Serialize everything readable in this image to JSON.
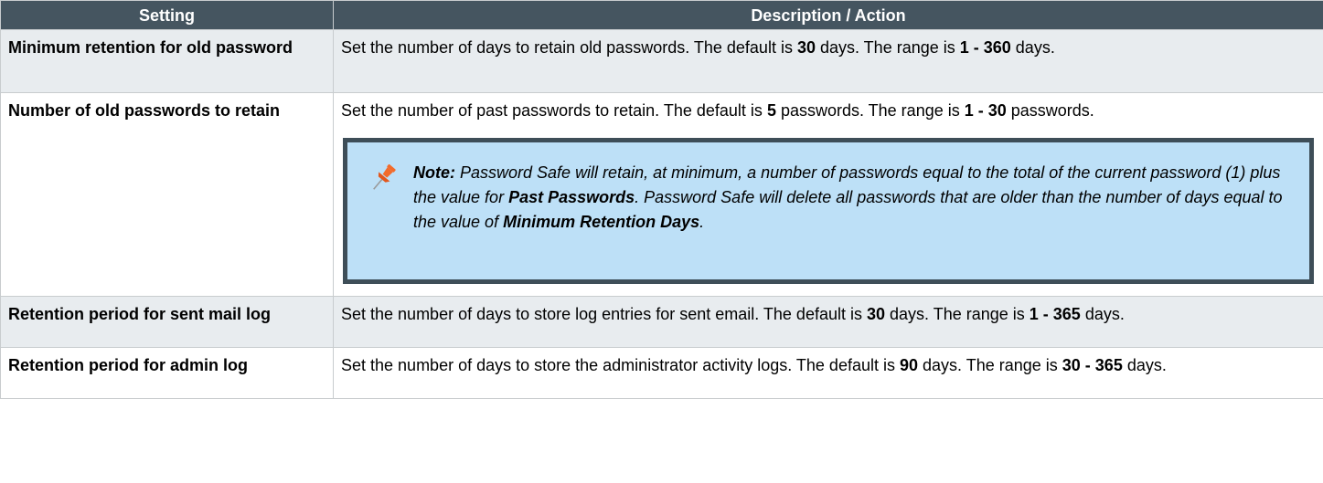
{
  "header": {
    "col_setting": "Setting",
    "col_description": "Description / Action"
  },
  "rows": [
    {
      "setting": "Minimum retention for old password",
      "d1": "Set the number of days to retain old passwords. The default is ",
      "b1": "30",
      "d2": " days. The range is ",
      "b2": "1 - 360",
      "d3": " days."
    },
    {
      "setting": "Number of old passwords to retain",
      "d1": "Set the number of past passwords to retain. The default is ",
      "b1": "5",
      "d2": " passwords. The range is ",
      "b2": "1 - 30",
      "d3": " passwords.",
      "note": {
        "icon": "pushpin-icon",
        "label": "Note:",
        "t1": " Password Safe will retain, at minimum, a number of passwords equal to the total of the current password (1) plus the value for ",
        "b1": "Past Passwords",
        "t2": ". Password Safe will delete all passwords that are older than the number of days equal to the value of ",
        "b2": "Minimum Retention Days",
        "t3": "."
      }
    },
    {
      "setting": "Retention period for sent mail log",
      "d1": "Set the number of days to store log entries for sent email. The default is ",
      "b1": "30",
      "d2": " days. The range is ",
      "b2": "1 - 365",
      "d3": " days."
    },
    {
      "setting": "Retention period for admin log",
      "d1": "Set the number of days to store the administrator activity logs. The default is ",
      "b1": "90",
      "d2": " days. The range is ",
      "b2": "30 - 365",
      "d3": " days."
    }
  ],
  "colors": {
    "header_bg": "#455560",
    "shaded_row_bg": "#e8ecef",
    "note_bg": "#bde0f7",
    "note_border": "#3e4e58",
    "pin_color": "#f26b2b"
  }
}
